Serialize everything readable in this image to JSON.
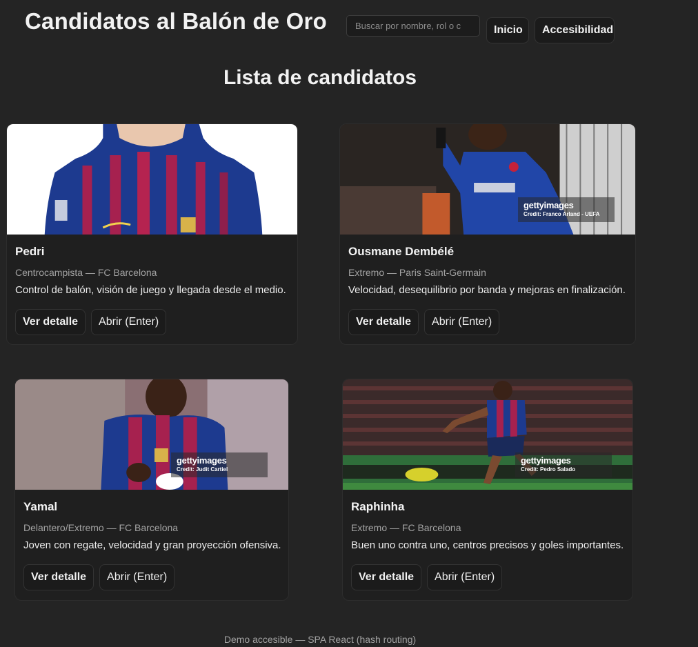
{
  "header": {
    "title": "Candidatos al Balón de Oro",
    "search_placeholder": "Buscar por nombre, rol o c",
    "nav": {
      "home": "Inicio",
      "accessibility": "Accesibilidad"
    }
  },
  "main": {
    "heading": "Lista de candidatos",
    "detail_label": "Ver detalle",
    "open_label": "Abrir (Enter)",
    "candidates": [
      {
        "name": "Pedri",
        "role": "Centrocampista — FC Barcelona",
        "description": "Control de balón, visión de juego y llegada desde el medio."
      },
      {
        "name": "Ousmane Dembélé",
        "role": "Extremo — Paris Saint-Germain",
        "description": "Velocidad, desequilibrio por banda y mejoras en finalización.",
        "watermark": "gettyimages",
        "credit": "Credit: Franco Arland - UEFA"
      },
      {
        "name": "Yamal",
        "role": "Delantero/Extremo — FC Barcelona",
        "description": "Joven con regate, velocidad y gran proyección ofensiva.",
        "watermark": "gettyimages",
        "credit": "Credit: Judit Cartiel"
      },
      {
        "name": "Raphinha",
        "role": "Extremo — FC Barcelona",
        "description": "Buen uno contra uno, centros precisos y goles importantes.",
        "watermark": "gettyimages",
        "credit": "Credit: Pedro Salado"
      }
    ]
  },
  "footer": {
    "text": "Demo accesible — SPA React (hash routing)"
  },
  "colors": {
    "background": "#242424",
    "card": "#1f1f1f",
    "barca_blue": "#1d3a8f",
    "barca_red": "#a6214f",
    "psg_blue": "#2146a8"
  }
}
